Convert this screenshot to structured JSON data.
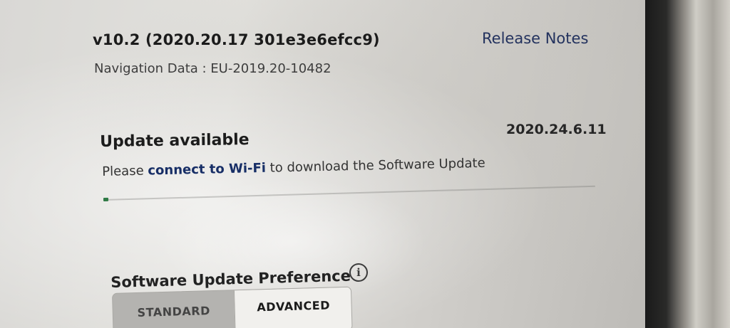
{
  "software": {
    "version": "v10.2 (2020.20.17 301e3e6efcc9)",
    "release_notes_label": "Release Notes",
    "navigation_data": "Navigation Data : EU-2019.20-10482"
  },
  "update": {
    "title": "Update available",
    "version": "2020.24.6.11",
    "message_prefix": "Please ",
    "message_link": "connect to Wi-Fi",
    "message_suffix": " to download the Software Update",
    "progress_percent": 1
  },
  "preference": {
    "title": "Software Update Preference",
    "info_icon": "info-circle-icon",
    "info_glyph": "i",
    "options": [
      "STANDARD",
      "ADVANCED"
    ],
    "selected": "ADVANCED"
  },
  "colors": {
    "link": "#172e66",
    "progress": "#2f7a45"
  }
}
